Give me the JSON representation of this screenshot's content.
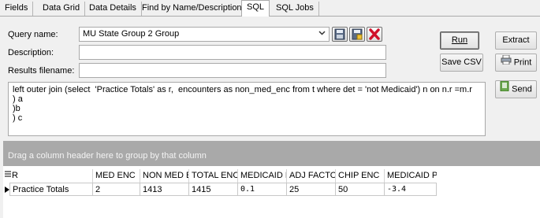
{
  "tabs": [
    {
      "label": "Fields",
      "active": false
    },
    {
      "label": "Data Grid",
      "active": false
    },
    {
      "label": "Data Details",
      "active": false
    },
    {
      "label": "Find by Name/Description",
      "active": false
    },
    {
      "label": "SQL",
      "active": true
    },
    {
      "label": "SQL Jobs",
      "active": false
    }
  ],
  "form": {
    "query_name_label": "Query name:",
    "query_name_value": "MU State Group 2 Group",
    "description_label": "Description:",
    "description_value": "",
    "results_filename_label": "Results filename:",
    "results_filename_value": ""
  },
  "buttons": {
    "run": "Run",
    "extract": "Extract",
    "save_csv": "Save CSV",
    "print": "Print",
    "send": "Send"
  },
  "icons": {
    "save": "save-icon",
    "save_as": "save-as-icon",
    "delete": "delete-icon",
    "print": "printer-icon",
    "send": "send-icon"
  },
  "sql_text": "left outer join (select  'Practice Totals' as r,  encounters as non_med_enc from t where det = 'not Medicaid') n on n.r =m.r\n) a\n)b\n) c",
  "group_hint": "Drag a column header here to group by that column",
  "grid": {
    "columns": [
      "R",
      "MED ENC",
      "NON MED EN",
      "TOTAL ENC",
      "MEDICAID P",
      "ADJ FACTOR",
      "CHIP ENC",
      "MEDICAID P"
    ],
    "rows": [
      [
        "Practice Totals",
        "2",
        "1413",
        "1415",
        "0.1",
        "25",
        "50",
        "-3.4"
      ]
    ]
  },
  "colors": {
    "group_bar": "#a9a9a9",
    "delete_red": "#d0102a"
  }
}
